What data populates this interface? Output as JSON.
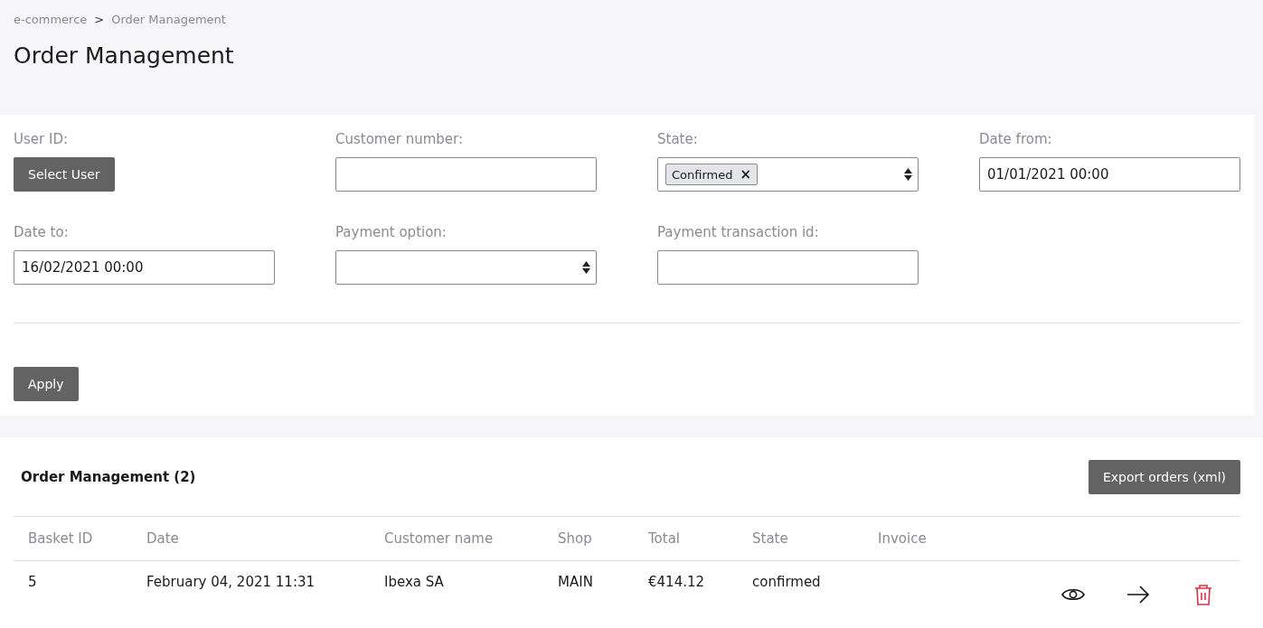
{
  "breadcrumb": [
    {
      "label": "e-commerce"
    },
    {
      "label": "Order Management"
    }
  ],
  "breadcrumb_separator": ">",
  "title": "Order Management",
  "filters": [
    {
      "label": "User ID:",
      "kind": "button",
      "button": "Select User"
    },
    {
      "label": "Customer number:",
      "kind": "text"
    },
    {
      "label": "State:",
      "kind": "select",
      "tags": [
        {
          "label": "Confirmed",
          "remove": "×"
        }
      ]
    },
    {
      "label": "Date from:",
      "kind": "text",
      "value": "01/01/2021 00:00"
    },
    {
      "label": "Date to:",
      "kind": "text",
      "value": "16/02/2021 00:00"
    },
    {
      "label": "Payment option:",
      "kind": "select"
    },
    {
      "label": "Payment transaction id:",
      "kind": "text"
    }
  ],
  "apply_button": "Apply",
  "table": {
    "title": "Order Management (2)",
    "export_button": "Export orders (xml)",
    "columns": [
      "Basket ID",
      "Date",
      "Customer name",
      "Shop",
      "Total",
      "State",
      "Invoice"
    ],
    "rows": [
      {
        "cells": [
          "5",
          "February 04, 2021 11:31",
          "Ibexa SA",
          "MAIN",
          "€414.12",
          "confirmed"
        ],
        "actions": [
          {
            "kind": "view"
          },
          {
            "kind": "open"
          },
          {
            "kind": "delete"
          }
        ]
      }
    ]
  }
}
